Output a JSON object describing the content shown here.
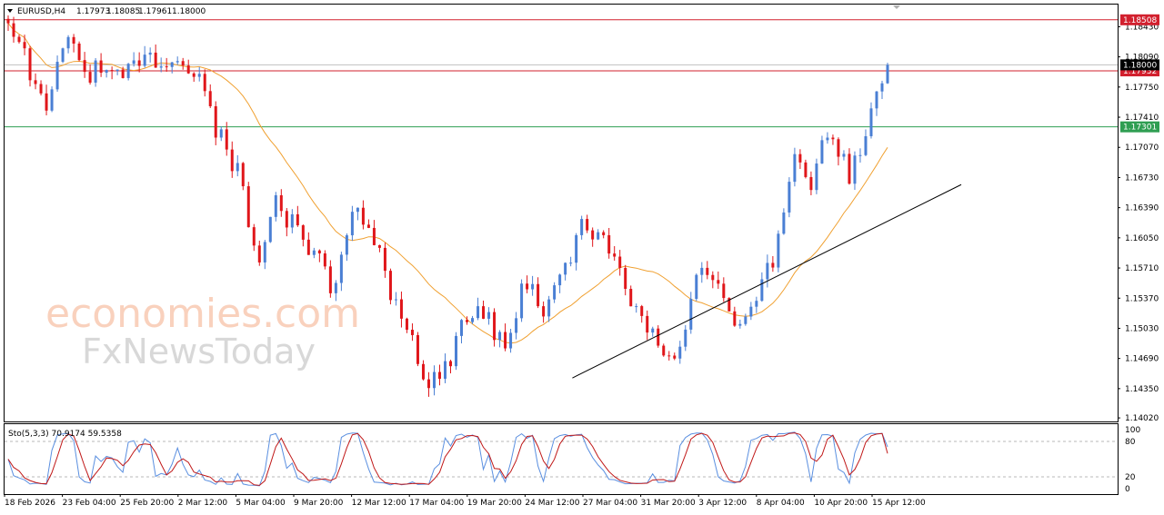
{
  "header": {
    "symbol": "EURUSD,H4",
    "open": "1.17973",
    "high": "1.18085",
    "low": "1.17961",
    "close": "1.18000"
  },
  "watermark": {
    "brand1": "economies.com",
    "brand2": "FxNewsToday"
  },
  "colors": {
    "bull": "#4a7fd4",
    "bear": "#e0161a",
    "ma": "#f0a030",
    "resistance": "#d2202e",
    "support": "#2f9e52",
    "trendline": "#000000",
    "stoch_main": "#5a8fe0",
    "stoch_signal": "#c01818"
  },
  "chart_data": [
    {
      "type": "candlestick",
      "title": "EURUSD,H4",
      "y_ticks": [
        "1.18430",
        "1.18090",
        "1.17750",
        "1.17410",
        "1.17070",
        "1.16730",
        "1.16390",
        "1.16050",
        "1.15710",
        "1.15370",
        "1.15030",
        "1.14690",
        "1.14350",
        "1.14020"
      ],
      "ylim": [
        1.1398,
        1.1868
      ],
      "x_ticks": [
        "18 Feb 2026",
        "23 Feb 04:00",
        "25 Feb 20:00",
        "2 Mar 12:00",
        "5 Mar 04:00",
        "9 Mar 20:00",
        "12 Mar 12:00",
        "17 Mar 04:00",
        "19 Mar 20:00",
        "24 Mar 12:00",
        "27 Mar 04:00",
        "31 Mar 20:00",
        "3 Apr 12:00",
        "8 Apr 04:00",
        "10 Apr 20:00",
        "15 Apr 12:00"
      ],
      "price_levels": [
        {
          "name": "resistance",
          "value": 1.18508,
          "label": "1.18508"
        },
        {
          "name": "current-level",
          "value": 1.17932,
          "label": "1.17932"
        },
        {
          "name": "support",
          "value": 1.17301,
          "label": "1.17301"
        }
      ],
      "current_price": {
        "value": 1.18,
        "label": "1.18000"
      },
      "trendline": {
        "from": {
          "bar": 0.592,
          "price": 1.1447
        },
        "to": {
          "bar": 1.0,
          "price": 1.1665
        }
      },
      "ohlc_keypoints": [
        [
          1.1845,
          1.179
        ],
        [
          1.18,
          1.181
        ],
        [
          1.176,
          1.175
        ],
        [
          1.183,
          1.1812
        ],
        [
          1.179,
          1.178
        ],
        [
          1.18,
          1.1782
        ],
        [
          1.179,
          1.1822
        ],
        [
          1.1815,
          1.1798
        ],
        [
          1.18,
          1.179
        ],
        [
          1.179,
          1.18
        ],
        [
          1.179,
          1.175
        ],
        [
          1.172,
          1.17
        ],
        [
          1.168,
          1.16
        ],
        [
          1.158,
          1.163
        ],
        [
          1.164,
          1.162
        ],
        [
          1.162,
          1.16
        ],
        [
          1.159,
          1.153
        ],
        [
          1.155,
          1.16
        ],
        [
          1.164,
          1.166
        ],
        [
          1.162,
          1.158
        ],
        [
          1.154,
          1.152
        ],
        [
          1.15,
          1.146
        ],
        [
          1.144,
          1.144
        ],
        [
          1.146,
          1.151
        ],
        [
          1.152,
          1.154
        ],
        [
          1.152,
          1.147
        ],
        [
          1.148,
          1.158
        ],
        [
          1.156,
          1.154
        ],
        [
          1.152,
          1.149
        ],
        [
          1.156,
          1.164
        ],
        [
          1.162,
          1.16
        ],
        [
          1.161,
          1.157
        ],
        [
          1.156,
          1.154
        ],
        [
          1.152,
          1.151
        ],
        [
          1.149,
          1.146
        ],
        [
          1.147,
          1.154
        ],
        [
          1.156,
          1.161
        ],
        [
          1.156,
          1.154
        ],
        [
          1.151,
          1.1525
        ],
        [
          1.154,
          1.156
        ],
        [
          1.158,
          1.167
        ],
        [
          1.169,
          1.168
        ],
        [
          1.167,
          1.17
        ],
        [
          1.173,
          1.169
        ],
        [
          1.167,
          1.171
        ],
        [
          1.174,
          1.175
        ],
        [
          1.178,
          1.18
        ]
      ],
      "volatility": 0.0012
    },
    {
      "type": "line",
      "title": "Sto(5,3,3) 70.9174 59.5358",
      "indicator_label": "Sto(5,3,3) 70.9174 59.5358",
      "y_ticks": [
        "100",
        "80",
        "20",
        "0"
      ],
      "ylim": [
        0,
        100
      ],
      "levels": [
        80,
        20
      ],
      "main_value": 70.9174,
      "signal_value": 59.5358,
      "series": [
        {
          "values": []
        },
        {
          "values": []
        }
      ]
    }
  ]
}
